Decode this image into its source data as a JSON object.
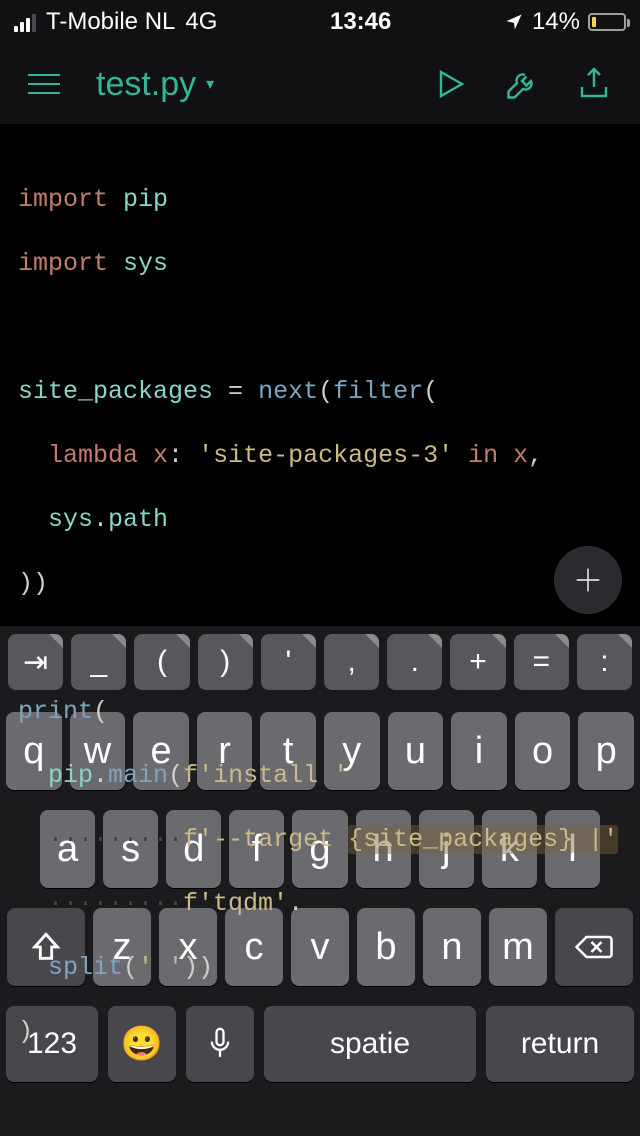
{
  "status": {
    "carrier": "T-Mobile NL",
    "network": "4G",
    "time": "13:46",
    "battery_pct": "14%"
  },
  "header": {
    "filename": "test.py"
  },
  "code": {
    "l1": {
      "kw": "import",
      "id": "pip"
    },
    "l2": {
      "kw": "import",
      "id": "sys"
    },
    "l3": {
      "id": "site_packages",
      "eq": " = ",
      "fn": "next",
      "p1": "(",
      "fn2": "filter",
      "p2": "("
    },
    "l4": {
      "pad": "  ",
      "kw": "lambda",
      "x": " x",
      "p": ": ",
      "str": "'site-packages-3'",
      "in": " in ",
      "x2": "x",
      "comma": ","
    },
    "l5": {
      "pad": "  ",
      "id": "sys",
      "dot": ".",
      "id2": "path"
    },
    "l6": {
      "p": "))"
    },
    "l7": {
      "fn": "print",
      "p": "("
    },
    "l8": {
      "pad": "  ",
      "id": "pip",
      "dot": ".",
      "fn": "main",
      "p": "(",
      "str": "f'install '"
    },
    "l9": {
      "pad": "  ",
      "dots": "·········",
      "str1": "f'--target ",
      "fmt": "{site_packages}",
      "cursor": " |'"
    },
    "l10": {
      "pad": "  ",
      "dots": "·········",
      "str": "f'tqdm'",
      "dot": "."
    },
    "l11": {
      "pad": "  ",
      "fn": "split",
      "p1": "(",
      "str": "' '",
      "p2": "))"
    },
    "l12": {
      "p": ")"
    }
  },
  "accessory_keys": [
    "⇥",
    "_",
    "(",
    ")",
    "'",
    ",",
    ".",
    "+",
    "=",
    ":"
  ],
  "keyboard": {
    "row1": [
      "q",
      "w",
      "e",
      "r",
      "t",
      "y",
      "u",
      "i",
      "o",
      "p"
    ],
    "row2": [
      "a",
      "s",
      "d",
      "f",
      "g",
      "h",
      "j",
      "k",
      "l"
    ],
    "row3": [
      "z",
      "x",
      "c",
      "v",
      "b",
      "n",
      "m"
    ],
    "numbers": "123",
    "space": "spatie",
    "return": "return"
  }
}
